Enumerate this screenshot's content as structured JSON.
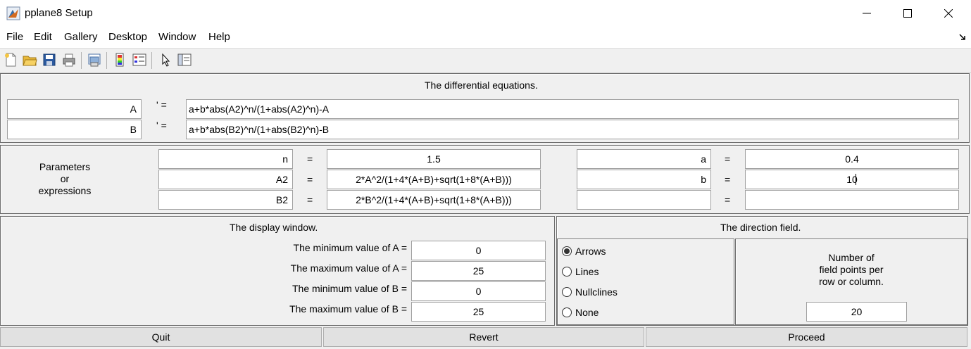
{
  "window": {
    "title": "pplane8 Setup",
    "minimize_label": "—",
    "maximize_label": "☐",
    "close_label": "✕"
  },
  "menu": [
    "File",
    "Edit",
    "Gallery",
    "Desktop",
    "Window",
    "Help"
  ],
  "toolbar": {
    "icons": [
      "new-file-icon",
      "open-folder-icon",
      "save-icon",
      "print-icon",
      "print-preview-icon",
      "colorbar-icon",
      "legend-icon",
      "pointer-icon",
      "property-editor-icon"
    ]
  },
  "equations": {
    "header": "The differential equations.",
    "prime_label": "' =",
    "rows": [
      {
        "var": "A",
        "expr": "a+b*abs(A2)^n/(1+abs(A2)^n)-A"
      },
      {
        "var": "B",
        "expr": "a+b*abs(B2)^n/(1+abs(B2)^n)-B"
      }
    ]
  },
  "parameters": {
    "side_label_1": "Parameters",
    "side_label_2": "or",
    "side_label_3": "expressions",
    "eq": "=",
    "left": [
      {
        "name": "n",
        "value": "1.5"
      },
      {
        "name": "A2",
        "value": "2*A^2/(1+4*(A+B)+sqrt(1+8*(A+B)))"
      },
      {
        "name": "B2",
        "value": "2*B^2/(1+4*(A+B)+sqrt(1+8*(A+B)))"
      }
    ],
    "right": [
      {
        "name": "a",
        "value": "0.4"
      },
      {
        "name": "b",
        "value": "10"
      },
      {
        "name": "",
        "value": ""
      }
    ]
  },
  "display_window": {
    "header": "The display window.",
    "rows": [
      {
        "label": "The minimum value of A =",
        "value": "0"
      },
      {
        "label": "The maximum value of A =",
        "value": "25"
      },
      {
        "label": "The minimum value of B =",
        "value": "0"
      },
      {
        "label": "The maximum value of B =",
        "value": "25"
      }
    ]
  },
  "direction_field": {
    "header": "The direction field.",
    "options": [
      "Arrows",
      "Lines",
      "Nullclines",
      "None"
    ],
    "selected": "Arrows",
    "points_label_1": "Number of",
    "points_label_2": "field points per",
    "points_label_3": "row or column.",
    "points_value": "20"
  },
  "buttons": {
    "quit": "Quit",
    "revert": "Revert",
    "proceed": "Proceed"
  }
}
